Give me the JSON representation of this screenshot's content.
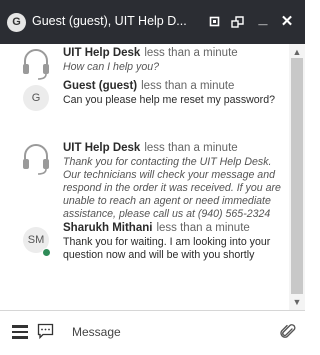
{
  "window": {
    "title": "Guest (guest), UIT Help D...",
    "avatar_initial": "G",
    "icons": [
      "stop-icon",
      "popout-icon",
      "minimize-icon",
      "close-icon"
    ],
    "minimize_glyph": "_",
    "close_glyph": "✕"
  },
  "messages": [
    {
      "author": "UIT Help Desk",
      "time": "less than a minute",
      "text": "How can I help you?",
      "avatar_type": "headset",
      "italic": true
    },
    {
      "author": "Guest (guest)",
      "time": "less than a minute",
      "text": "Can you please help me reset my password?",
      "avatar_type": "initials",
      "initials": "G",
      "italic": false
    },
    {
      "author": "UIT Help Desk",
      "time": "less than a minute",
      "text": "Thank you for contacting the UIT Help Desk. Our technicians will check your message and respond in the order it was received. If you are unable to reach an agent or need immediate assistance, please call us at (940) 565-2324",
      "avatar_type": "headset",
      "italic": true
    },
    {
      "author": "Sharukh Mithani",
      "time": "less than a minute",
      "text": "Thank you for waiting. I am looking into your question now and will be with you shortly",
      "avatar_type": "initials",
      "initials": "SM",
      "online": true,
      "italic": false
    }
  ],
  "composer": {
    "placeholder": "Message",
    "icons": [
      "menu-icon",
      "chat-bubble-icon",
      "paperclip-icon"
    ]
  },
  "colors": {
    "titlebar": "#2b2d33",
    "online": "#2e8b57"
  }
}
